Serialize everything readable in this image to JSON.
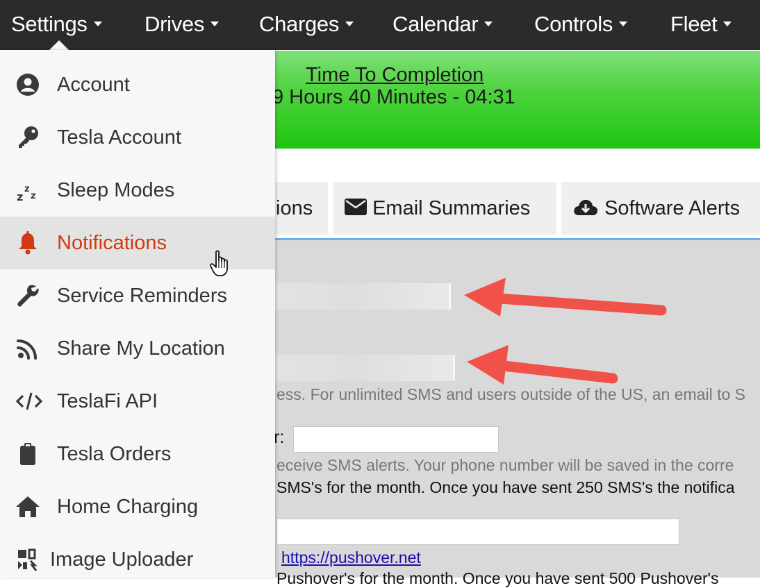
{
  "navbar": {
    "items": [
      {
        "label": "Settings"
      },
      {
        "label": "Drives"
      },
      {
        "label": "Charges"
      },
      {
        "label": "Calendar"
      },
      {
        "label": "Controls"
      },
      {
        "label": "Fleet"
      }
    ]
  },
  "banner": {
    "title": "Time To Completion",
    "time": "9 Hours 40 Minutes - 04:31"
  },
  "tabs": [
    {
      "label": "ions",
      "icon": "clipped-icon"
    },
    {
      "label": "Email Summaries",
      "icon": "envelope-icon"
    },
    {
      "label": "Software Alerts",
      "icon": "cloud-download-icon"
    }
  ],
  "settings_menu": {
    "items": [
      {
        "label": "Account",
        "icon": "user-circle-icon"
      },
      {
        "label": "Tesla Account",
        "icon": "key-icon"
      },
      {
        "label": "Sleep Modes",
        "icon": "sleep-icon"
      },
      {
        "label": "Notifications",
        "icon": "bell-icon",
        "active": true
      },
      {
        "label": "Service Reminders",
        "icon": "wrench-icon"
      },
      {
        "label": "Share My Location",
        "icon": "rss-icon"
      },
      {
        "label": "TeslaFi API",
        "icon": "code-icon"
      },
      {
        "label": "Tesla Orders",
        "icon": "clipboard-icon"
      },
      {
        "label": "Home Charging",
        "icon": "home-icon"
      },
      {
        "label": "Image Uploader",
        "icon": "image-upload-icon"
      }
    ]
  },
  "content": {
    "sms_note": "ess. For unlimited SMS and users outside of the US, an email to S",
    "phone_label": "r:",
    "phone_value": "",
    "phone_help": "eceive SMS alerts. Your phone number will be saved in the corre",
    "sms_count": "SMS's for the month. Once you have sent 250 SMS's the notifica",
    "pushover_value": "",
    "pushover_link": "https://pushover.net",
    "pushover_count": "Pushover's for the month. Once you have sent 500 Pushover's"
  },
  "colors": {
    "navbar_bg": "#2b2b2b",
    "banner_green": "#1fc611",
    "active_menu": "#d03a12",
    "annotation_arrow": "#f0524a",
    "tab_underline": "#6aaef0"
  }
}
